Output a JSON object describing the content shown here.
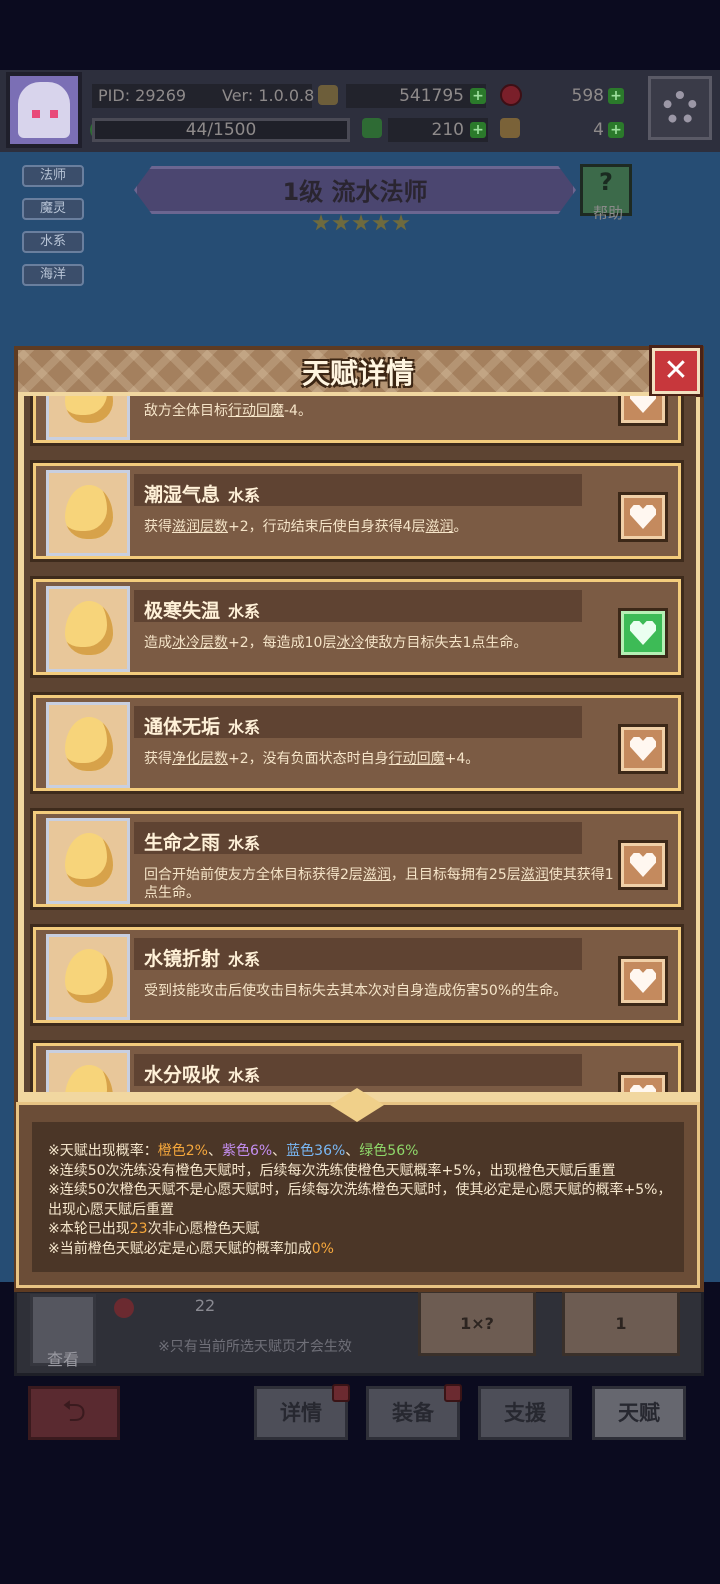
{
  "header": {
    "pid": "PID: 29269",
    "ver": "Ver: 1.0.0.8",
    "gold": "541795",
    "gems": "598",
    "exp": "44/1500",
    "clover": "210",
    "keys": "4"
  },
  "class_tags": [
    "法师",
    "魔灵",
    "水系",
    "海洋"
  ],
  "title_banner": "1级  流水法师",
  "help_label": "帮助",
  "modal": {
    "title": "天赋详情",
    "close_label": "✕",
    "talents": [
      {
        "name": "",
        "type": "",
        "desc_parts": [
          [
            "敌方全体目标",
            false
          ],
          [
            "行动回魔",
            true
          ],
          [
            "-4。",
            false
          ]
        ],
        "favorited": false
      },
      {
        "name": "潮湿气息",
        "type": "水系",
        "desc_parts": [
          [
            "获得",
            false
          ],
          [
            "滋润层数",
            true
          ],
          [
            "+2，行动结束后使自身获得4层",
            false
          ],
          [
            "滋润",
            true
          ],
          [
            "。",
            false
          ]
        ],
        "favorited": false
      },
      {
        "name": "极寒失温",
        "type": "水系",
        "desc_parts": [
          [
            "造成",
            false
          ],
          [
            "冰冷层数",
            true
          ],
          [
            "+2，每造成10层",
            false
          ],
          [
            "冰冷",
            true
          ],
          [
            "使敌方目标失去1点生命。",
            false
          ]
        ],
        "favorited": true
      },
      {
        "name": "通体无垢",
        "type": "水系",
        "desc_parts": [
          [
            "获得",
            false
          ],
          [
            "净化层数",
            true
          ],
          [
            "+2，没有负面状态时自身",
            false
          ],
          [
            "行动回魔",
            true
          ],
          [
            "+4。",
            false
          ]
        ],
        "favorited": false
      },
      {
        "name": "生命之雨",
        "type": "水系",
        "desc_parts": [
          [
            "回合开始前使友方全体目标获得2层",
            false
          ],
          [
            "滋润",
            true
          ],
          [
            "，且目标每拥有25层",
            false
          ],
          [
            "滋润",
            true
          ],
          [
            "使其获得1点生命。",
            false
          ]
        ],
        "favorited": false
      },
      {
        "name": "水镜折射",
        "type": "水系",
        "desc_parts": [
          [
            "受到技能攻击后使攻击目标失去其本次对自身造成伤害50%的生命。",
            false
          ]
        ],
        "favorited": false
      },
      {
        "name": "水分吸收",
        "type": "水系",
        "desc_parts": [],
        "favorited": false
      }
    ]
  },
  "info": {
    "line1_prefix": "※天赋出现概率：",
    "orange": "橙色2%",
    "sep1": "、",
    "purple": "紫色6%",
    "sep2": "、",
    "blue": "蓝色36%",
    "sep3": "、",
    "green": "绿色56%",
    "line2": "※连续50次洗练没有橙色天赋时，后续每次洗练使橙色天赋概率+5%，出现橙色天赋后重置",
    "line3": "※连续50次橙色天赋不是心愿天赋时，后续每次洗练橙色天赋时，使其必定是心愿天赋的概率+5%，出现心愿天赋后重置",
    "line4_prefix": "※本轮已出现",
    "line4_count": "23",
    "line4_suffix": "次非心愿橙色天赋",
    "line5_prefix": "※当前橙色天赋必定是心愿天赋的概率加成",
    "line5_value": "0%"
  },
  "bottom": {
    "view_label": "查看",
    "bag_count": "22",
    "hint": "※只有当前所选天赋页才会生效",
    "auto_wash_sub": "1×?",
    "talent_wash_sub": "1"
  },
  "nav": {
    "details": "详情",
    "equip": "装备",
    "support": "支援",
    "talent": "天赋"
  }
}
